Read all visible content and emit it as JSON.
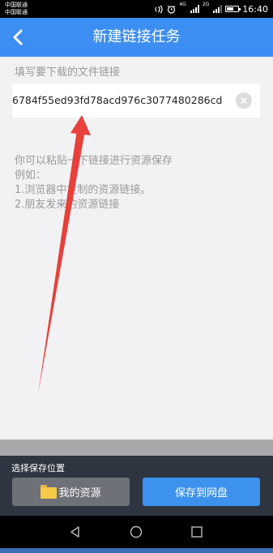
{
  "status_bar": {
    "carrier_1": "中国联通",
    "carrier_2": "中国联通",
    "network_1": "4G",
    "network_2": "2G",
    "time": "16:40",
    "battery_level": 0.6
  },
  "header": {
    "title": "新建链接任务",
    "back_icon": "chevron-left-icon"
  },
  "form": {
    "label": "填写要下载的文件链接",
    "link_value": "6784f55ed93fd78acd976c3077480286cd",
    "clear_icon": "close-icon"
  },
  "hint": {
    "lines": [
      "你可以粘贴一下链接进行资源保存",
      "例如：",
      "1.浏览器中复制的资源链接。",
      "2.朋友发来的资源链接"
    ]
  },
  "bottom": {
    "save_location_label": "选择保存位置",
    "my_resources_label": "我的资源",
    "folder_icon": "folder-icon",
    "save_button_label": "保存到网盘"
  },
  "nav": {
    "back_icon": "triangle-back-icon",
    "home_icon": "circle-home-icon",
    "recents_icon": "square-recents-icon"
  },
  "colors": {
    "header": "#3d8ef2",
    "bottom_bar": "#2e3540",
    "secondary_button": "#6e7178",
    "primary_button": "#3d92ee",
    "annotation_arrow": "#e8403a"
  }
}
